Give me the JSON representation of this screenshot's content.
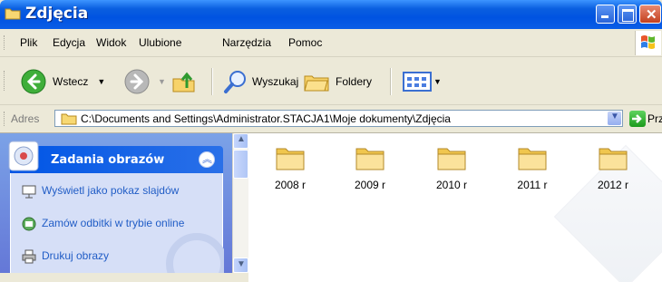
{
  "window": {
    "title": "Zdjęcia"
  },
  "menu": {
    "items": [
      "Plik",
      "Edycja",
      "Widok",
      "Ulubione",
      "Narzędzia",
      "Pomoc"
    ]
  },
  "toolbar": {
    "back_label": "Wstecz",
    "search_label": "Wyszukaj",
    "folders_label": "Foldery"
  },
  "address": {
    "label": "Adres",
    "path": "C:\\Documents and Settings\\Administrator.STACJA1\\Moje dokumenty\\Zdjęcia",
    "go_label": "Przejdź"
  },
  "taskpane": {
    "title": "Zadania obrazów",
    "items": [
      {
        "label": "Wyświetl jako pokaz slajdów",
        "icon": "slideshow-icon"
      },
      {
        "label": "Zamów odbitki w trybie online",
        "icon": "order-prints-icon"
      },
      {
        "label": "Drukuj obrazy",
        "icon": "print-icon"
      }
    ]
  },
  "folders": [
    "2008 r",
    "2009 r",
    "2010 r",
    "2011 r",
    "2012 r"
  ],
  "colors": {
    "titlebar": "#0053e1",
    "taskpane_bg": "#6375d6",
    "link": "#215dc6",
    "folder": "#f5d573"
  }
}
